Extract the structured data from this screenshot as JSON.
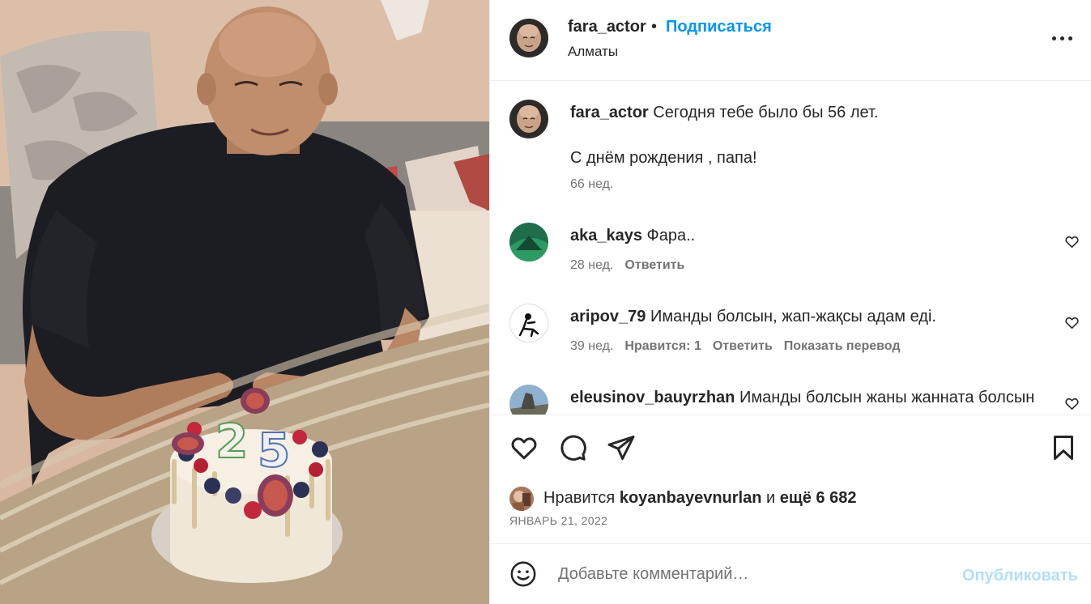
{
  "post": {
    "author": "fara_actor",
    "separator": "•",
    "follow_label": "Подписаться",
    "location": "Алматы",
    "more_icon": "more-horizontal-icon"
  },
  "caption": {
    "user": "fara_actor",
    "line1": "Сегодня тебе было бы 56 лет.",
    "line2": "С днём рождения , папа!",
    "time": "66 нед."
  },
  "comments": [
    {
      "user": "aka_kays",
      "text": "Фара..",
      "time": "28 нед.",
      "reply": "Ответить"
    },
    {
      "user": "aripov_79",
      "text": "Иманды болсын, жап-жақсы адам еді.",
      "time": "39 нед.",
      "likes": "Нравится: 1",
      "reply": "Ответить",
      "translate": "Показать перевод"
    },
    {
      "user": "eleusinov_bauyrzhan",
      "text": "Иманды болсын жаны жанната болсын"
    }
  ],
  "actions": {
    "like_icon": "heart-outline-icon",
    "comment_icon": "comment-bubble-icon",
    "share_icon": "paper-plane-icon",
    "save_icon": "bookmark-icon"
  },
  "likes": {
    "prefix": "Нравится",
    "user": "koyanbayevnurlan",
    "joiner": "и",
    "others": "ещё 6 682"
  },
  "date": "ЯНВАРЬ 21, 2022",
  "add_comment": {
    "placeholder": "Добавьте комментарий…",
    "publish": "Опубликовать"
  },
  "colors": {
    "link_blue": "#0095f6",
    "publish_disabled": "#b2dffc",
    "meta_gray": "#737373",
    "text": "#262626"
  }
}
